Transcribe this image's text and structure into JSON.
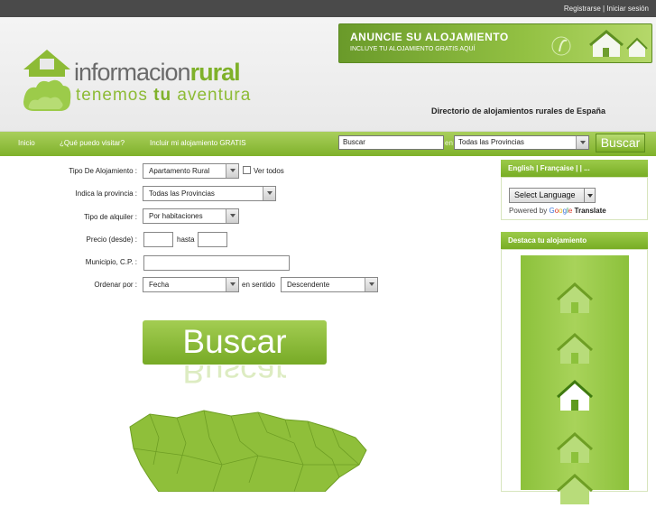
{
  "topbar": {
    "register": "Registrarse",
    "separator": " | ",
    "login": "Iniciar sesión"
  },
  "header": {
    "logo_part1": "informacion",
    "logo_part2": "rural",
    "logo_slogan1": "tenemos ",
    "logo_slogan2": "tu",
    "logo_slogan3": " aventura",
    "banner_title": "ANUNCIE SU ALOJAMIENTO",
    "banner_sub": "INCLUYE TU ALOJAMIENTO GRATIS AQUÍ",
    "tagline": "Directorio de alojamientos rurales de España"
  },
  "nav": {
    "items": [
      "Inicio",
      "¿Qué puedo visitar?",
      "Incluir mi alojamiento GRATIS"
    ],
    "search_value": "Buscar",
    "en_label": "en",
    "province_value": "Todas las Provincias",
    "search_button": "Buscar"
  },
  "form": {
    "tipo_label": "Tipo De Alojamiento :",
    "tipo_value": "Apartamento Rural",
    "ver_todos": "Ver todos",
    "provincia_label": "Indica la provincia :",
    "provincia_value": "Todas las Provincias",
    "alquiler_label": "Tipo de alquiler :",
    "alquiler_value": "Por habitaciones",
    "precio_label": "Precio (desde) :",
    "hasta_label": "hasta",
    "municipio_label": "Municipio, C.P. :",
    "ordenar_label": "Ordenar por :",
    "ordenar_value": "Fecha",
    "sentido_label": "en sentido",
    "sentido_value": "Descendente",
    "submit_label": "Buscar"
  },
  "sidebar": {
    "lang_links": "English | Française |      | ...",
    "translate_button": "Select Language",
    "powered_by": "Powered by",
    "google": [
      "G",
      "o",
      "o",
      "g",
      "l",
      "e"
    ],
    "translate_word": "Translate",
    "destaca_title": "Destaca tu alojamiento"
  },
  "colors": {
    "brand_green": "#7fb12a",
    "light_green": "#a9cf5c",
    "topbar": "#4a4a4a"
  }
}
